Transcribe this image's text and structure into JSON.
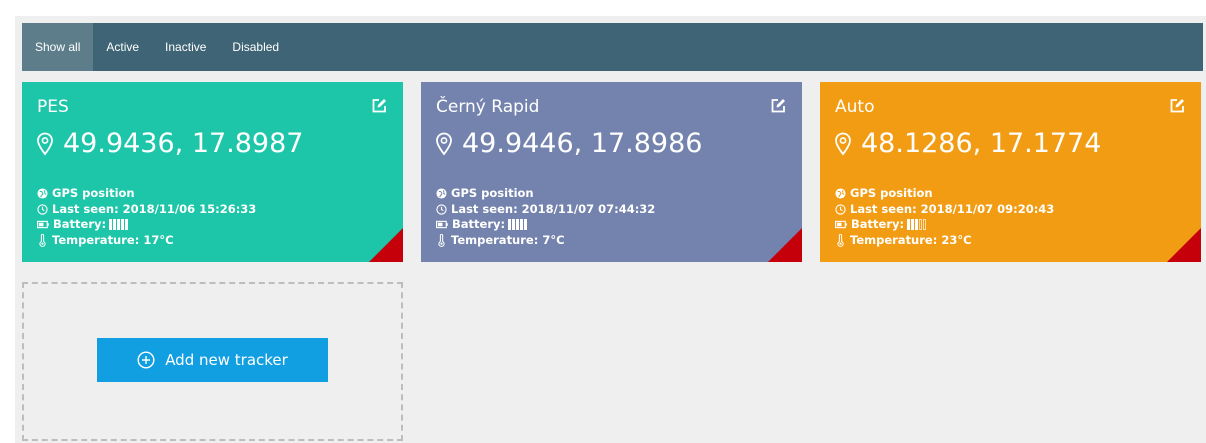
{
  "filters": {
    "tabs": [
      {
        "label": "Show all"
      },
      {
        "label": "Active"
      },
      {
        "label": "Inactive"
      },
      {
        "label": "Disabled"
      }
    ]
  },
  "colors": {
    "filterbar": "#3f6475",
    "active_tab": "#5d7d8b",
    "card_pes": "#1ec6a9",
    "card_cerny": "#7483ad",
    "card_auto": "#f29c13",
    "corner_badge": "#c5000b",
    "add_button": "#119fe2"
  },
  "trackers": [
    {
      "name": "PES",
      "coords": "49.9436, 17.8987",
      "gps_label": "GPS position",
      "last_seen": "Last seen: 2018/11/06 15:26:33",
      "battery_label": "Battery:",
      "battery_level": 5,
      "battery_max": 5,
      "temperature": "Temperature: 17°C"
    },
    {
      "name": "Černý Rapid",
      "coords": "49.9446, 17.8986",
      "gps_label": "GPS position",
      "last_seen": "Last seen: 2018/11/07 07:44:32",
      "battery_label": "Battery:",
      "battery_level": 5,
      "battery_max": 5,
      "temperature": "Temperature: 7°C"
    },
    {
      "name": "Auto",
      "coords": "48.1286, 17.1774",
      "gps_label": "GPS position",
      "last_seen": "Last seen: 2018/11/07 09:20:43",
      "battery_label": "Battery:",
      "battery_level": 3,
      "battery_max": 5,
      "temperature": "Temperature: 23°C"
    }
  ],
  "add_tracker": {
    "label": "Add new tracker",
    "icon": "plus-circle-icon"
  }
}
